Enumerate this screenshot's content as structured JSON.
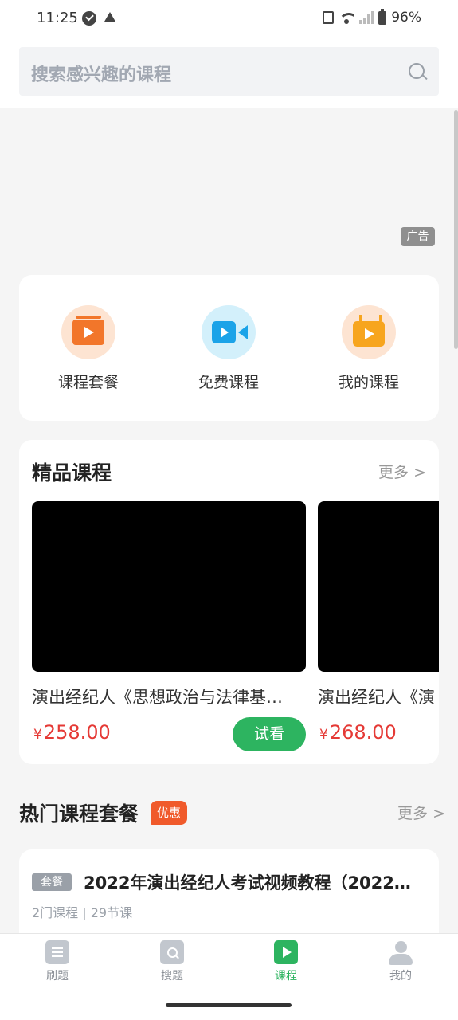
{
  "status_bar": {
    "time": "11:25",
    "battery": "96%",
    "icons": [
      "check-circle-icon",
      "warning-icon",
      "vibrate-icon",
      "wifi-icon",
      "signal-icon",
      "battery-icon"
    ]
  },
  "search": {
    "placeholder": "搜索感兴趣的课程"
  },
  "ad": {
    "tag": "广告"
  },
  "quick_links": [
    {
      "label": "课程套餐",
      "icon": "package-play-icon",
      "color": "#f2762a"
    },
    {
      "label": "免费课程",
      "icon": "video-camera-icon",
      "color": "#1ba3e8"
    },
    {
      "label": "我的课程",
      "icon": "tv-play-icon",
      "color": "#f7a51e"
    }
  ],
  "premium": {
    "title": "精品课程",
    "more": "更多 >",
    "courses": [
      {
        "title": "演出经纪人《思想政治与法律基…",
        "currency": "¥",
        "price": "258.00",
        "button": "试看"
      },
      {
        "title": "演出经纪人《演",
        "currency": "¥",
        "price": "268.00"
      }
    ]
  },
  "hot_packages": {
    "title": "热门课程套餐",
    "badge": "优惠",
    "more": "更多 >",
    "items": [
      {
        "tag": "套餐",
        "title": "2022年演出经纪人考试视频教程（2022…",
        "meta": "2门课程 | 29节课"
      }
    ]
  },
  "tabs": [
    {
      "label": "刷题",
      "icon": "practice-icon",
      "active": false
    },
    {
      "label": "搜题",
      "icon": "search-question-icon",
      "active": false
    },
    {
      "label": "课程",
      "icon": "course-play-icon",
      "active": true
    },
    {
      "label": "我的",
      "icon": "profile-icon",
      "active": false
    }
  ],
  "colors": {
    "accent_green": "#2db460",
    "price_red": "#e53935",
    "promo_orange": "#f05a2b"
  }
}
